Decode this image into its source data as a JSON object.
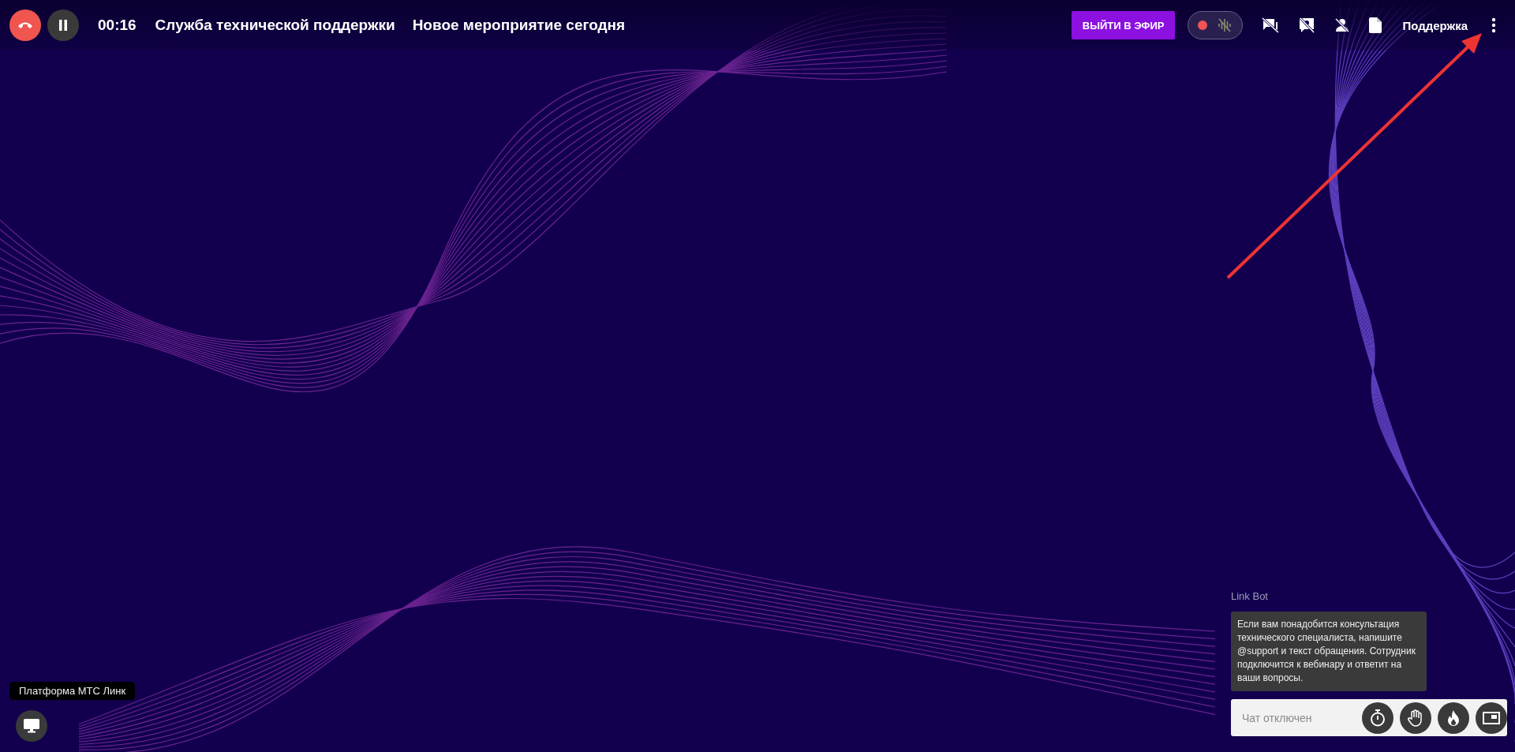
{
  "top_bar": {
    "timer": "00:16",
    "room_title": "Служба технической поддержки",
    "event_title": "Новое мероприятие сегодня",
    "go_live_button": "ВЫЙТИ В ЭФИР",
    "recording_on": false,
    "support_link": "Поддержка"
  },
  "chat": {
    "sender": "Link Bot",
    "message": "Если вам понадобится консультация технического специалиста, напишите @support и текст обращения. Сотрудник подключится к вебинару и ответит на ваши вопросы.",
    "placeholder": "Чат отключен"
  },
  "platform_label": "Платформа МТС Линк"
}
